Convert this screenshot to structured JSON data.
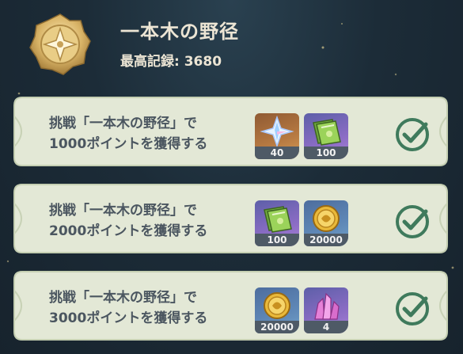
{
  "event": {
    "title": "一本木の野径",
    "record_label": "最高記録:",
    "record_value": "3680",
    "record_text": "最高記録: 3680"
  },
  "tasks": [
    {
      "line1": "挑戦「一本木の野径」で",
      "line2": "1000ポイントを獲得する",
      "completed": true,
      "rewards": [
        {
          "icon": "primogem-icon",
          "rarity": 5,
          "quantity": "40"
        },
        {
          "icon": "heros-wit-book-icon",
          "rarity": 4,
          "quantity": "100"
        }
      ]
    },
    {
      "line1": "挑戦「一本木の野径」で",
      "line2": "2000ポイントを獲得する",
      "completed": true,
      "rewards": [
        {
          "icon": "heros-wit-book-icon",
          "rarity": 4,
          "quantity": "100"
        },
        {
          "icon": "mora-coin-icon",
          "rarity": 3,
          "quantity": "20000"
        }
      ]
    },
    {
      "line1": "挑戦「一本木の野径」で",
      "line2": "3000ポイントを獲得する",
      "completed": true,
      "rewards": [
        {
          "icon": "mora-coin-icon",
          "rarity": 3,
          "quantity": "20000"
        },
        {
          "icon": "crystal-ore-icon",
          "rarity": 4,
          "quantity": "4"
        }
      ]
    }
  ],
  "colors": {
    "card_bg": "#e3e8d6",
    "card_border": "#c5cfb2",
    "text_dark": "#4b5660",
    "check_green": "#3f7a5c",
    "header_text": "#ece5d4"
  }
}
